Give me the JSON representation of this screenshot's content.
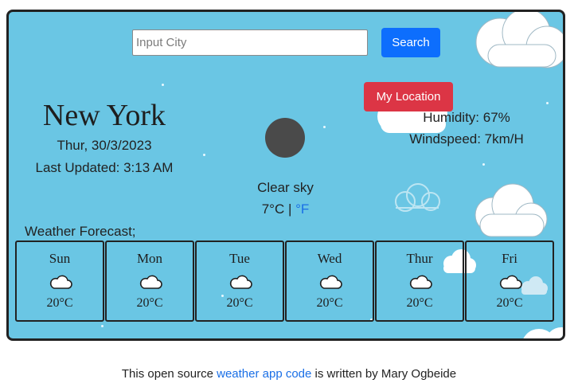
{
  "search": {
    "placeholder": "Input City",
    "value": "",
    "button_label": "Search"
  },
  "location_button": "My Location",
  "current": {
    "city": "New York",
    "date": "Thur, 30/3/2023",
    "last_updated": "Last Updated: 3:13 AM",
    "description": "Clear sky",
    "temp_c": "7°C",
    "separator": " | ",
    "unit_f": "°F",
    "humidity": "Humidity: 67%",
    "windspeed": "Windspeed: 7km/H",
    "icon": "weather-icon-dark-circle"
  },
  "forecast": {
    "title": "Weather Forecast;",
    "days": [
      {
        "name": "Sun",
        "temp": "20°C",
        "icon": "cloud-icon"
      },
      {
        "name": "Mon",
        "temp": "20°C",
        "icon": "cloud-icon"
      },
      {
        "name": "Tue",
        "temp": "20°C",
        "icon": "cloud-icon"
      },
      {
        "name": "Wed",
        "temp": "20°C",
        "icon": "cloud-icon"
      },
      {
        "name": "Thur",
        "temp": "20°C",
        "icon": "cloud-icon"
      },
      {
        "name": "Fri",
        "temp": "20°C",
        "icon": "cloud-icon"
      }
    ]
  },
  "footer": {
    "prefix": "This open source ",
    "link_text": "weather app code",
    "suffix": " is written by Mary Ogbeide"
  },
  "colors": {
    "sky": "#6ac6e4",
    "search_button": "#0d6efd",
    "location_button": "#dc3545",
    "link": "#1a6fe6"
  }
}
